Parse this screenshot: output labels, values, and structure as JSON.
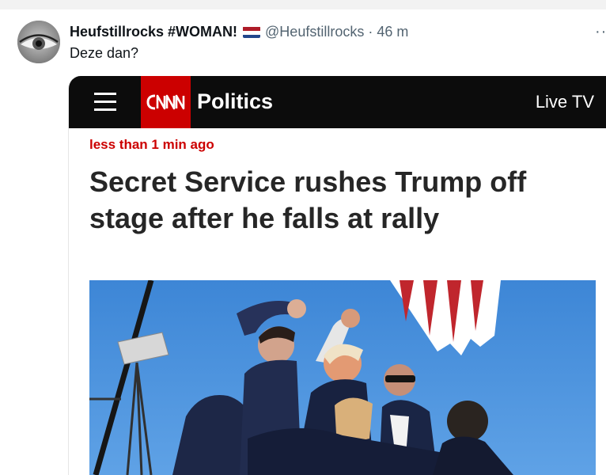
{
  "tweet": {
    "display_name": "Heufstillrocks #WOMAN!",
    "flag_icon": "netherlands-flag-icon",
    "handle": "@Heufstillrocks",
    "separator": "·",
    "time": "46 m",
    "more_icon": "more-options-icon",
    "text": "Deze dan?"
  },
  "article": {
    "logo_text": "CNN",
    "section": "Politics",
    "live_tv": "Live TV",
    "menu_icon": "hamburger-menu-icon",
    "timestamp": "less than 1 min ago",
    "headline": "Secret Service rushes Trump off stage after he falls at rally",
    "accent_color": "#cc0000"
  }
}
